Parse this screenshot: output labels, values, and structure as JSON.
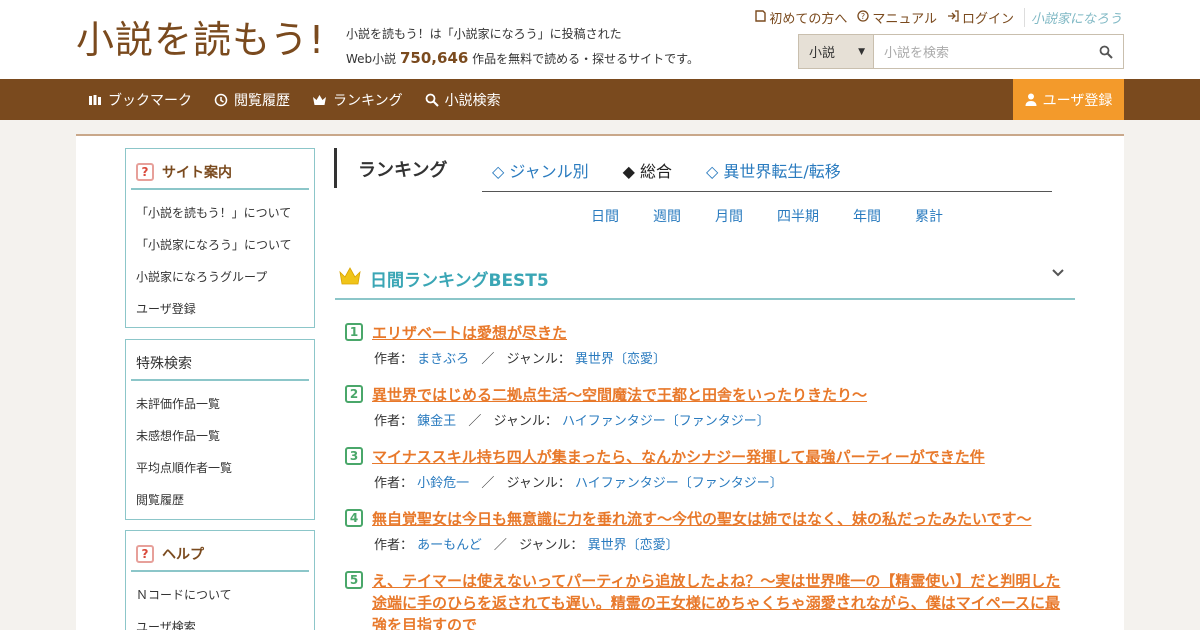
{
  "header": {
    "logo": "小説を読もう!",
    "desc_line1": "小説を読もう！は「小説家になろう」に投稿された",
    "desc_prefix": "Web小説",
    "desc_count": "750,646",
    "desc_suffix": "作品を無料で読める・探せるサイトです。",
    "links": [
      {
        "icon": "guide-icon",
        "label": "初めての方へ"
      },
      {
        "icon": "manual-icon",
        "label": "マニュアル"
      },
      {
        "icon": "login-icon",
        "label": "ログイン"
      }
    ],
    "narou_logo": "小説家になろう",
    "search": {
      "select_value": "小説",
      "placeholder": "小説を検索"
    }
  },
  "nav": {
    "items": [
      {
        "icon": "bookmark-icon",
        "label": "ブックマーク"
      },
      {
        "icon": "history-icon",
        "label": "閲覧履歴"
      },
      {
        "icon": "crown-icon",
        "label": "ランキング"
      },
      {
        "icon": "search-icon",
        "label": "小説検索"
      }
    ],
    "register": "ユーザ登録"
  },
  "sidebar": {
    "site_guide": {
      "title": "サイト案内",
      "items": [
        "「小説を読もう！」について",
        "「小説家になろう」について",
        "小説家になろうグループ",
        "ユーザ登録"
      ]
    },
    "special_search": {
      "title": "特殊検索",
      "items": [
        "未評価作品一覧",
        "未感想作品一覧",
        "平均点順作者一覧",
        "閲覧履歴"
      ]
    },
    "help": {
      "title": "ヘルプ",
      "items": [
        "Ｎコードについて",
        "ユーザ検索"
      ]
    }
  },
  "ranking": {
    "title": "ランキング",
    "tabs": [
      "◇ ジャンル別",
      "◆ 総合",
      "◇ 異世界転生/転移"
    ],
    "periods": [
      "日間",
      "週間",
      "月間",
      "四半期",
      "年間",
      "累計"
    ],
    "section_title": "日間ランキングBEST5",
    "author_label": "作者：",
    "genre_label": "ジャンル：",
    "entries": [
      {
        "rank": "1",
        "title": "エリザベートは愛想が尽きた",
        "author": "まきぶろ",
        "genre": "異世界〔恋愛〕"
      },
      {
        "rank": "2",
        "title": "異世界ではじめる二拠点生活～空間魔法で王都と田舎をいったりきたり～",
        "author": "錬金王",
        "genre": "ハイファンタジー〔ファンタジー〕"
      },
      {
        "rank": "3",
        "title": "マイナススキル持ち四人が集まったら、なんかシナジー発揮して最強パーティーができた件",
        "author": "小鈴危一",
        "genre": "ハイファンタジー〔ファンタジー〕"
      },
      {
        "rank": "4",
        "title": "無自覚聖女は今日も無意識に力を垂れ流す〜今代の聖女は姉ではなく、妹の私だったみたいです〜",
        "author": "あーもんど",
        "genre": "異世界〔恋愛〕"
      },
      {
        "rank": "5",
        "title": "え、テイマーは使えないってパーティから追放したよね？～実は世界唯一の【精霊使い】だと判明した途端に手のひらを返されても遅い。精霊の王女様にめちゃくちゃ溺愛されながら、僕はマイペースに最強を目指すので"
      }
    ]
  },
  "colors": {
    "brand": "#7a4a1e",
    "accent": "#f39a2b",
    "teal": "#8cc6c9",
    "link": "#2a7bbf",
    "title_orange": "#e8792b"
  }
}
